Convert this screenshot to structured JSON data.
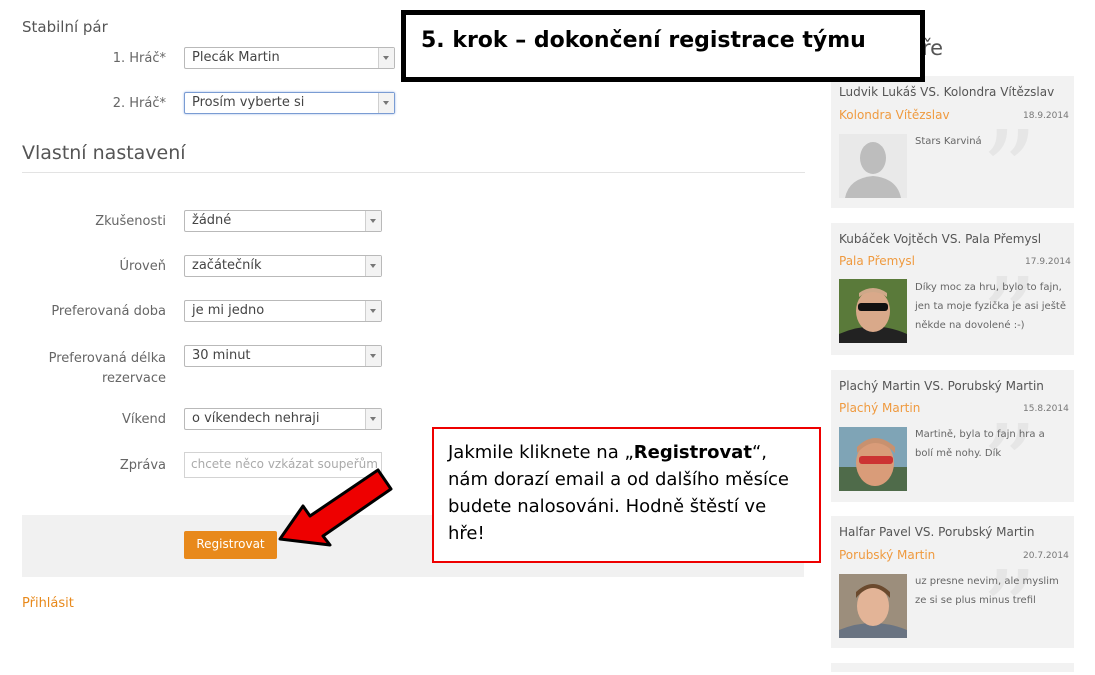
{
  "form": {
    "stable_pair_title": "Stabilní pár",
    "player1_label": "1. Hráč*",
    "player1_value": "Plecák Martin",
    "player2_label": "2. Hráč*",
    "player2_value": "Prosím vyberte si",
    "own_settings_title": "Vlastní nastavení",
    "fields": [
      {
        "label": "Zkušenosti",
        "value": "žádné"
      },
      {
        "label": "Úroveň",
        "value": "začátečník"
      },
      {
        "label": "Preferovaná doba",
        "value": "je mi jedno"
      },
      {
        "label": "Preferovaná délka rezervace",
        "value": "30 minut"
      },
      {
        "label": "Víkend",
        "value": "o víkendech nehraji"
      }
    ],
    "message_label": "Zpráva",
    "message_placeholder": "chcete něco vzkázat soupeřům",
    "register_button": "Registrovat",
    "login_link": "Přihlásit"
  },
  "sidebar": {
    "heading_partial": "ře",
    "cards": [
      {
        "title": "Ludvik Lukáš VS. Kolondra Vítězslav",
        "winner": "Kolondra Vítězslav",
        "date": "18.9.2014",
        "text": "Stars Karviná",
        "photo": "placeholder-avatar"
      },
      {
        "title": "Kubáček Vojtěch VS. Pala Přemysl",
        "winner": "Pala Přemysl",
        "date": "17.9.2014",
        "text": "Díky moc za hru, bylo to fajn, jen ta moje fyzička je asi ještě někde na dovolené :-)",
        "photo": "man-sunglasses"
      },
      {
        "title": "Plachý Martin VS. Porubský Martin",
        "winner": "Plachý Martin",
        "date": "15.8.2014",
        "text": "Martině, byla to fajn hra a bolí mě nohy. Dík",
        "photo": "man-sunglasses-outdoor"
      },
      {
        "title": "Halfar Pavel VS. Porubský Martin",
        "winner": "Porubský Martin",
        "date": "20.7.2014",
        "text": "uz presne nevim, ale myslim ze si se plus minus trefil",
        "photo": "young-man"
      }
    ]
  },
  "annotations": {
    "step_title": "5. krok – dokončení registrace týmu",
    "note_prefix": "Jakmile kliknete na „",
    "note_bold": "Registrovat",
    "note_suffix": "“, nám dorazí email a od dalšího měsíce budete nalosováni. Hodně štěstí ve hře!"
  },
  "colors": {
    "accent": "#e8891b",
    "annotation_red": "#e00000"
  }
}
